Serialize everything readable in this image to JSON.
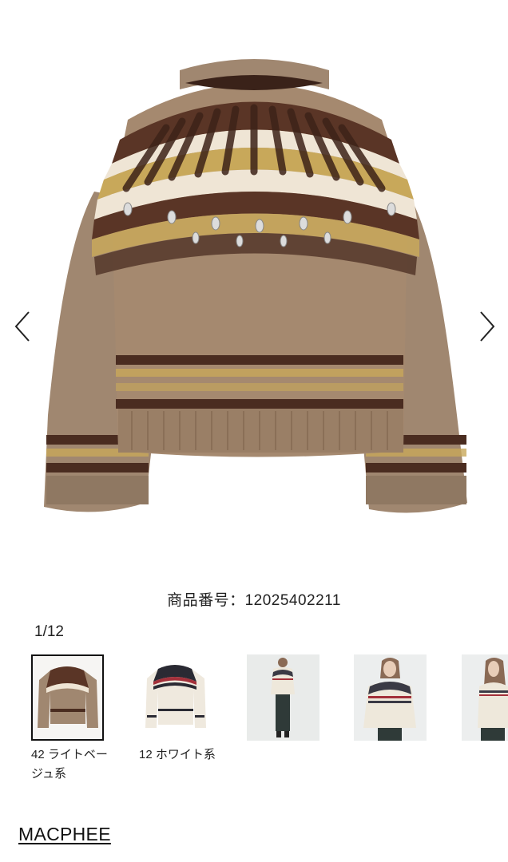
{
  "gallery": {
    "prev_icon": "chevron-left-icon",
    "next_icon": "chevron-right-icon",
    "counter": "1/12",
    "product_number_label": "商品番号：12025402211"
  },
  "colors": {
    "beige": "#a08770",
    "brown": "#4a2c20",
    "cream": "#efe5d5",
    "gold": "#c8a85a"
  },
  "thumbnails": [
    {
      "caption": "42 ライトベージュ系",
      "selected": true
    },
    {
      "caption": "12 ホワイト系",
      "selected": false
    },
    {
      "caption": "",
      "selected": false
    },
    {
      "caption": "",
      "selected": false
    },
    {
      "caption": "",
      "selected": false
    }
  ],
  "brand": {
    "name": "MACPHEE"
  }
}
